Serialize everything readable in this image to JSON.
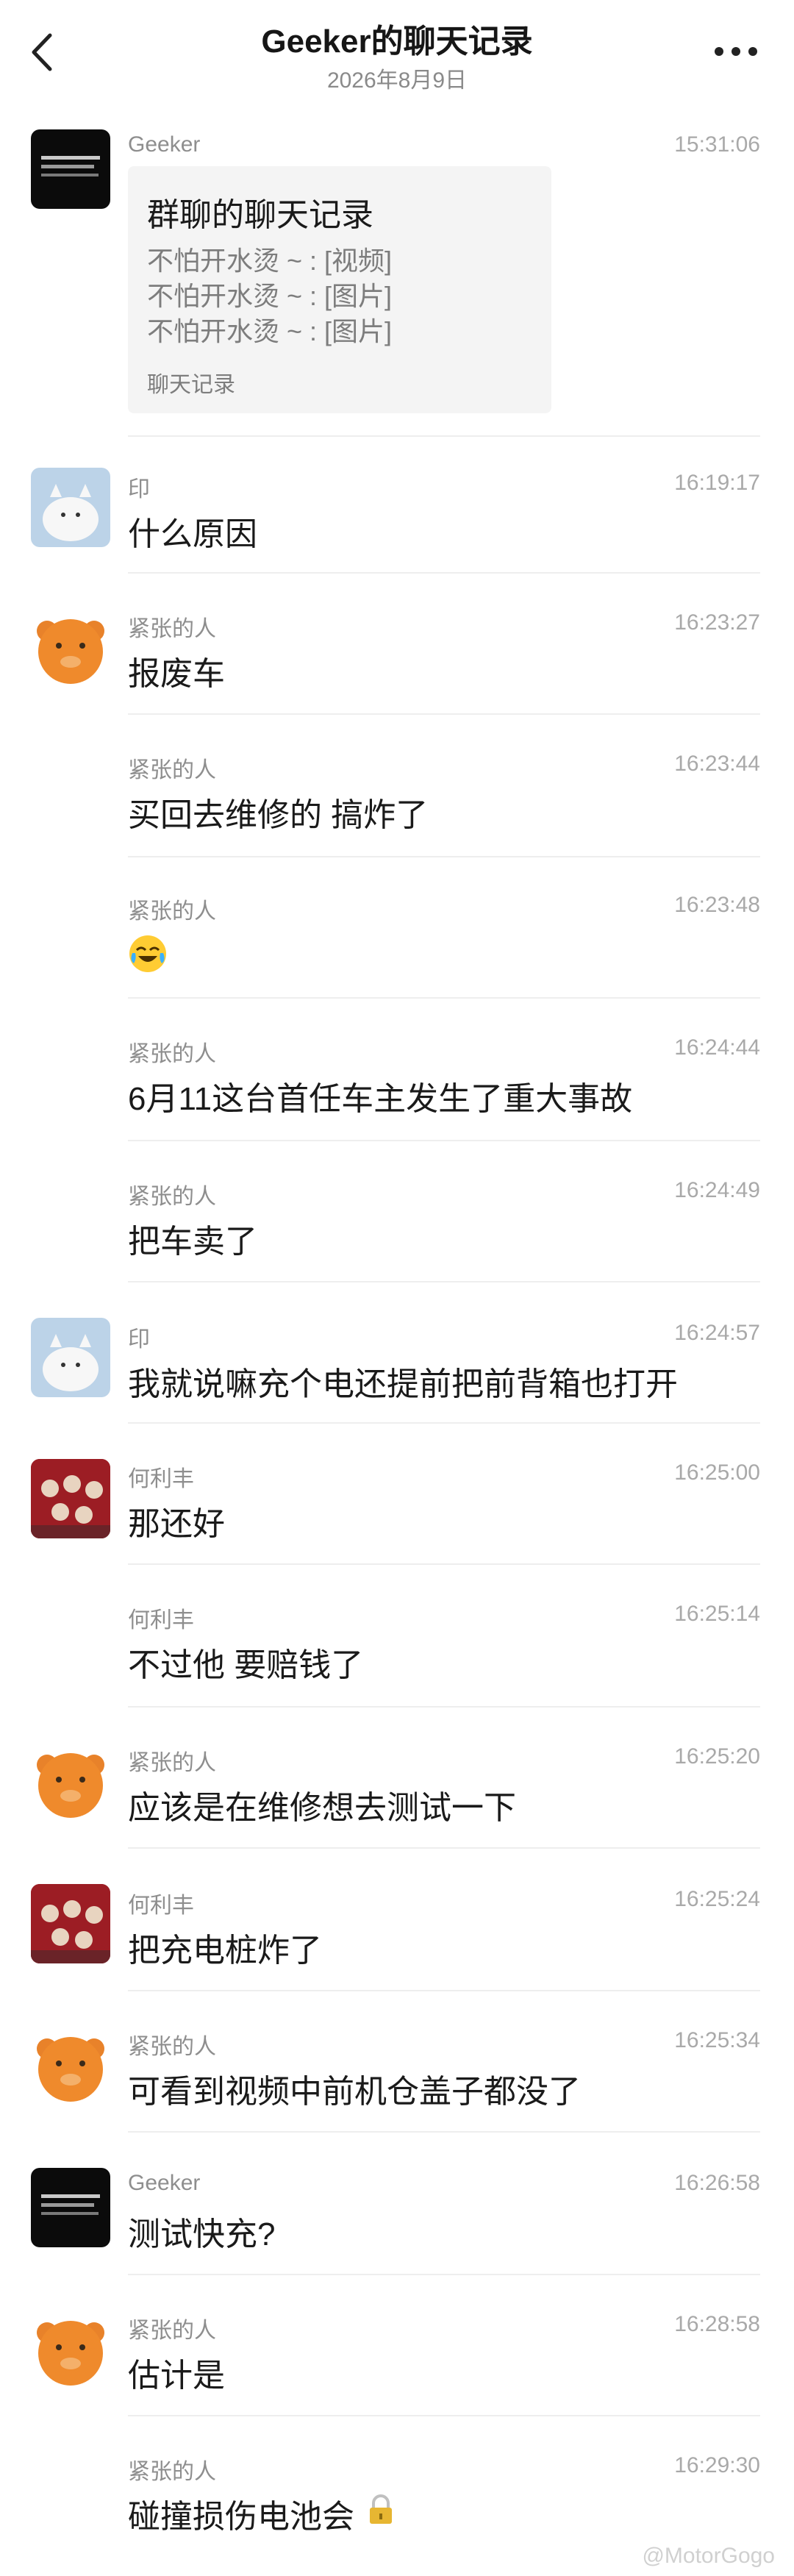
{
  "header": {
    "title": "Geeker的聊天记录",
    "date": "2026年8月9日"
  },
  "forward_card": {
    "title": "群聊的聊天记录",
    "lines": [
      "不怕开水烫 ~ : [视频]",
      "不怕开水烫 ~ : [图片]",
      "不怕开水烫 ~ : [图片]"
    ],
    "footer": "聊天记录"
  },
  "messages": [
    {
      "name": "Geeker",
      "time": "15:31:06",
      "text": "",
      "avatar": "geeker"
    },
    {
      "name": "印",
      "time": "16:19:17",
      "text": "什么原因",
      "avatar": "cat"
    },
    {
      "name": "紧张的人",
      "time": "16:23:27",
      "text": "报废车",
      "avatar": "bear"
    },
    {
      "name": "紧张的人",
      "time": "16:23:44",
      "text": "买回去维修的 搞炸了",
      "avatar": ""
    },
    {
      "name": "紧张的人",
      "time": "16:23:48",
      "text": "",
      "avatar": "",
      "emoji": "laugh-cry-emoji"
    },
    {
      "name": "紧张的人",
      "time": "16:24:44",
      "text": "6月11这台首任车主发生了重大事故",
      "avatar": ""
    },
    {
      "name": "紧张的人",
      "time": "16:24:49",
      "text": "把车卖了",
      "avatar": ""
    },
    {
      "name": "印",
      "time": "16:24:57",
      "text": "我就说嘛充个电还提前把前背箱也打开",
      "avatar": "cat"
    },
    {
      "name": "何利丰",
      "time": "16:25:00",
      "text": "那还好",
      "avatar": "red"
    },
    {
      "name": "何利丰",
      "time": "16:25:14",
      "text": "不过他 要赔钱了",
      "avatar": ""
    },
    {
      "name": "紧张的人",
      "time": "16:25:20",
      "text": "应该是在维修想去测试一下",
      "avatar": "bear"
    },
    {
      "name": "何利丰",
      "time": "16:25:24",
      "text": "把充电桩炸了",
      "avatar": "red"
    },
    {
      "name": "紧张的人",
      "time": "16:25:34",
      "text": "可看到视频中前机仓盖子都没了",
      "avatar": "bear"
    },
    {
      "name": "Geeker",
      "time": "16:26:58",
      "text": "测试快充?",
      "avatar": "geeker"
    },
    {
      "name": "紧张的人",
      "time": "16:28:58",
      "text": "估计是",
      "avatar": "bear"
    },
    {
      "name": "紧张的人",
      "time": "16:29:30",
      "text": "碰撞损伤电池会",
      "avatar": "",
      "emoji": "lock-icon"
    }
  ],
  "watermark": "@MotorGogo",
  "colors": {
    "bubble_bg": "#f4f4f4",
    "divider": "#eeeeee",
    "muted": "#8e8e8e"
  }
}
